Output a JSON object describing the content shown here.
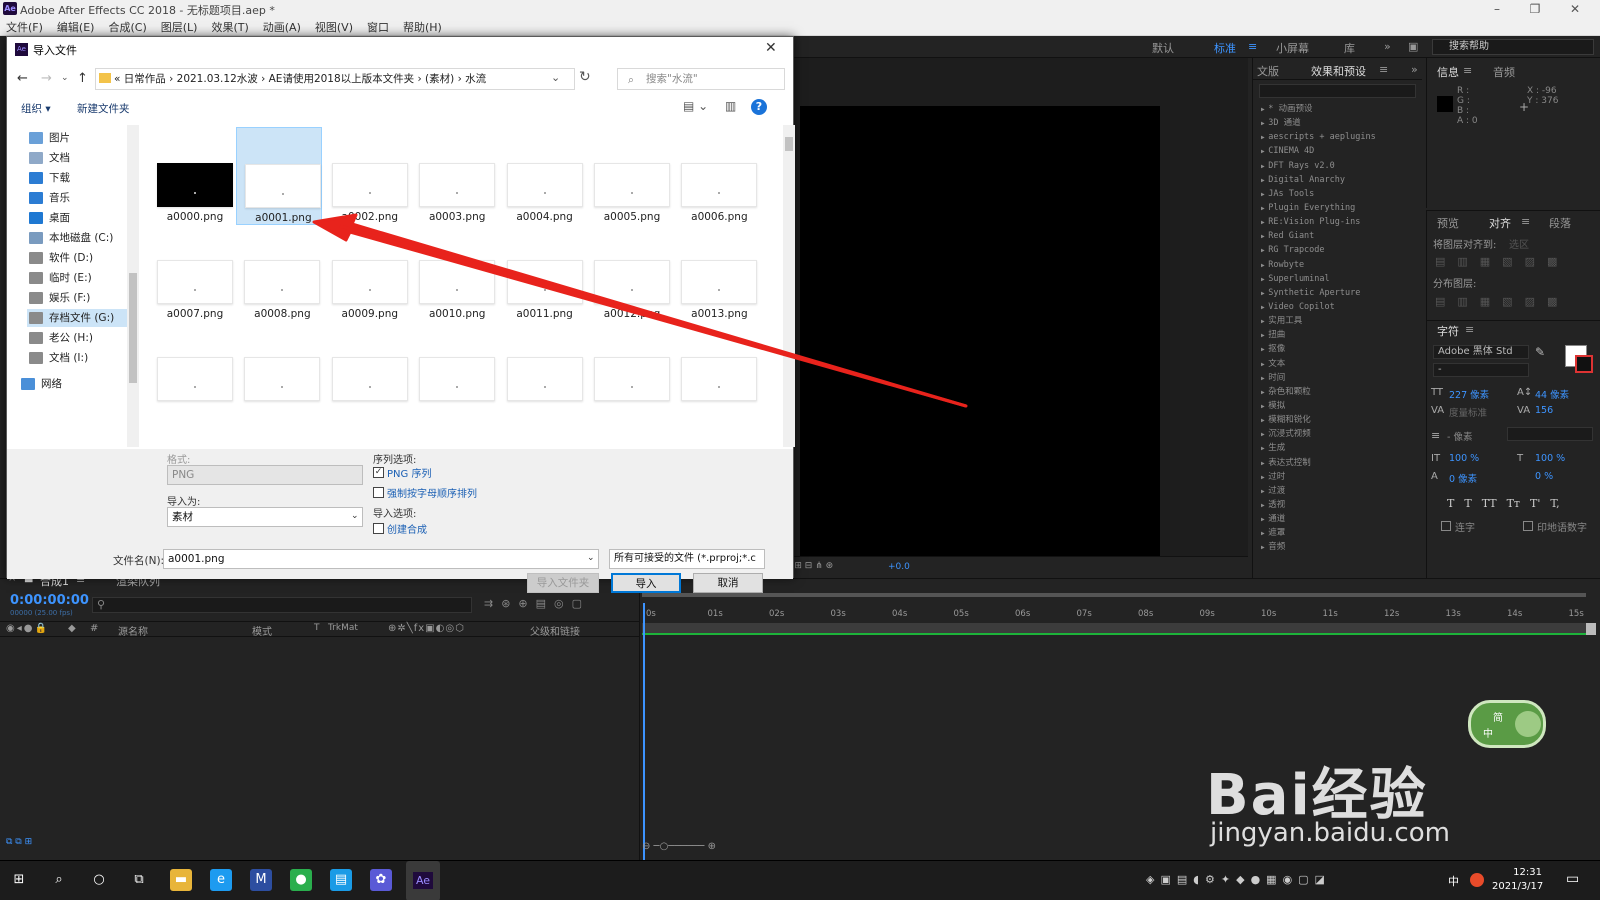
{
  "app": {
    "title": "Adobe After Effects CC 2018 - 无标题项目.aep *",
    "logo": "Ae"
  },
  "menu": [
    "文件(F)",
    "编辑(E)",
    "合成(C)",
    "图层(L)",
    "效果(T)",
    "动画(A)",
    "视图(V)",
    "窗口",
    "帮助(H)"
  ],
  "workspace": {
    "items": [
      "默认",
      "标准",
      "小屏幕",
      "库"
    ],
    "active": "标准",
    "help_placeholder": "搜索帮助"
  },
  "effects_panel": {
    "tabs": [
      "文版",
      "效果和预设"
    ],
    "items": [
      "* 动画预设",
      "3D 通道",
      "aescripts + aeplugins",
      "CINEMA 4D",
      "DFT Rays v2.0",
      "Digital Anarchy",
      "JAs Tools",
      "Plugin Everything",
      "RE:Vision Plug-ins",
      "Red Giant",
      "RG Trapcode",
      "Rowbyte",
      "Superluminal",
      "Synthetic Aperture",
      "Video Copilot",
      "实用工具",
      "扭曲",
      "抠像",
      "文本",
      "时间",
      "杂色和颗粒",
      "模拟",
      "模糊和锐化",
      "沉浸式视频",
      "生成",
      "表达式控制",
      "过时",
      "过渡",
      "透视",
      "通道",
      "遮罩",
      "音频"
    ]
  },
  "info_panel": {
    "tabs": [
      "信息",
      "音频"
    ],
    "rgba": [
      "R :",
      "G :",
      "B :",
      "A : 0"
    ],
    "x": "X : -96",
    "y": "Y : 376"
  },
  "align_panel": {
    "tabs": [
      "预览",
      "对齐",
      "段落"
    ],
    "align_to_label": "将图层对齐到:",
    "align_to_value": "选区",
    "distribute_label": "分布图层:"
  },
  "char_panel": {
    "title": "字符",
    "font": "Adobe 黑体 Std",
    "style": "-",
    "size": "227 像素",
    "leading": "44 像素",
    "kerning": "度量标准",
    "tracking": "156",
    "stroke": "- 像素",
    "vscale": "100 %",
    "hscale": "100 %",
    "baseline": "0 像素",
    "tsume": "0 %",
    "styles": [
      "T",
      "T",
      "TT",
      "Tт",
      "T'",
      "T,"
    ],
    "ligatures": "连字",
    "hindi": "印地语数字"
  },
  "viewer": {
    "zoom_extra": "+0.0"
  },
  "timeline": {
    "tabs": [
      "合成1",
      "渲染队列"
    ],
    "timecode": "0:00:00:00",
    "fps": "00000 (25.00 fps)",
    "columns": [
      "源名称",
      "模式",
      "T",
      "TrkMat",
      "父级和链接"
    ],
    "ticks": [
      "0s",
      "01s",
      "02s",
      "03s",
      "04s",
      "05s",
      "06s",
      "07s",
      "08s",
      "09s",
      "10s",
      "11s",
      "12s",
      "13s",
      "14s",
      "15s"
    ]
  },
  "dialog": {
    "title": "导入文件",
    "breadcrumb": "«  日常作品  ›  2021.03.12水波  ›  AE请使用2018以上版本文件夹  ›  (素材)  ›  水流",
    "search_placeholder": "搜索\"水流\"",
    "toolbar": {
      "organize": "组织 ▾",
      "new_folder": "新建文件夹"
    },
    "nav": [
      {
        "label": "图片",
        "color": "#6aa0d8"
      },
      {
        "label": "文档",
        "color": "#8fa9c8"
      },
      {
        "label": "下载",
        "color": "#2b7cd3"
      },
      {
        "label": "音乐",
        "color": "#2b7cd3"
      },
      {
        "label": "桌面",
        "color": "#1e78d2"
      },
      {
        "label": "本地磁盘 (C:)",
        "color": "#7a9bbf"
      },
      {
        "label": "软件 (D:)",
        "color": "#8a8a8a"
      },
      {
        "label": "临时 (E:)",
        "color": "#8a8a8a"
      },
      {
        "label": "娱乐 (F:)",
        "color": "#8a8a8a"
      },
      {
        "label": "存档文件 (G:)",
        "color": "#8a8a8a"
      },
      {
        "label": "老公 (H:)",
        "color": "#8a8a8a"
      },
      {
        "label": "文档 (I:)",
        "color": "#8a8a8a"
      },
      {
        "label": "网络",
        "color": "#4a8fd8"
      }
    ],
    "nav_selected": "存档文件 (G:)",
    "files": [
      "a0000.png",
      "a0001.png",
      "a0002.png",
      "a0003.png",
      "a0004.png",
      "a0005.png",
      "a0006.png",
      "a0007.png",
      "a0008.png",
      "a0009.png",
      "a0010.png",
      "a0011.png",
      "a0012.png",
      "a0013.png",
      "",
      "",
      "",
      "",
      "",
      "",
      ""
    ],
    "selected_file": "a0001.png",
    "format_label": "格式:",
    "format_value": "PNG",
    "import_as_label": "导入为:",
    "import_as_value": "素材",
    "sequence_label": "序列选项:",
    "png_sequence": "PNG 序列",
    "png_sequence_checked": true,
    "force_alpha": "强制按字母顺序排列",
    "force_alpha_checked": false,
    "import_opts_label": "导入选项:",
    "create_comp": "创建合成",
    "create_comp_checked": false,
    "filename_label": "文件名(N):",
    "filename_value": "a0001.png",
    "filter_value": "所有可接受的文件 (*.prproj;*.c",
    "btn_import_folder": "导入文件夹",
    "btn_import": "导入",
    "btn_cancel": "取消"
  },
  "taskbar": {
    "time": "12:31",
    "date": "2021/3/17",
    "ime": "中"
  },
  "watermark": {
    "text": "Bai经验",
    "url": "jingyan.baidu.com",
    "badge_top": "简",
    "badge_bottom": "中"
  },
  "colors": {
    "accent_blue": "#3d94ff",
    "arrow_red": "#e8231c",
    "selection": "#cce4f7"
  }
}
